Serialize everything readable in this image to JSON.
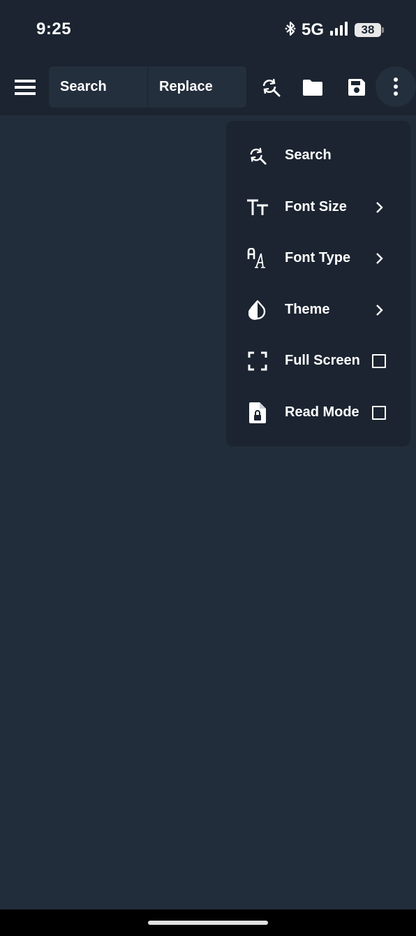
{
  "status_bar": {
    "time": "9:25",
    "network": "5G",
    "battery": "38"
  },
  "toolbar": {
    "search_placeholder": "Search",
    "replace_placeholder": "Replace"
  },
  "menu": {
    "items": [
      {
        "label": "Search",
        "icon": "search-replace-icon",
        "trailing": "none"
      },
      {
        "label": "Font Size",
        "icon": "font-size-icon",
        "trailing": "chevron"
      },
      {
        "label": "Font Type",
        "icon": "font-type-icon",
        "trailing": "chevron"
      },
      {
        "label": "Theme",
        "icon": "theme-drop-icon",
        "trailing": "chevron"
      },
      {
        "label": "Full Screen",
        "icon": "fullscreen-icon",
        "trailing": "checkbox",
        "checked": false
      },
      {
        "label": "Read Mode",
        "icon": "read-mode-lock-icon",
        "trailing": "checkbox",
        "checked": false
      }
    ]
  },
  "colors": {
    "background": "#222d3b",
    "bar": "#1b2430",
    "field": "#242f3d",
    "text": "#ffffff"
  }
}
